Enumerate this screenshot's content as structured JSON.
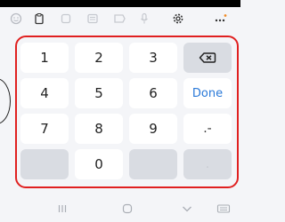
{
  "toolbar": {
    "icons": [
      "emoji-icon",
      "clipboard-icon",
      "sticker-icon",
      "keyboard-layout-icon",
      "gif-icon",
      "voice-input-icon",
      "settings-icon",
      "more-options-icon"
    ]
  },
  "keypad": {
    "row1": [
      "1",
      "2",
      "3"
    ],
    "row2": [
      "4",
      "5",
      "6"
    ],
    "row3": [
      "7",
      "8",
      "9"
    ],
    "row4_middle": "0",
    "done_label": "Done",
    "symbol_key_label": ".-",
    "period_key_label": "."
  },
  "colors": {
    "highlight": "#e02020",
    "done": "#2a79d8",
    "key_light": "#ffffff",
    "key_dark": "#d9dce2"
  },
  "nav": {
    "items": [
      "recent-apps-icon",
      "home-icon",
      "back-icon",
      "keyboard-switch-icon"
    ]
  }
}
